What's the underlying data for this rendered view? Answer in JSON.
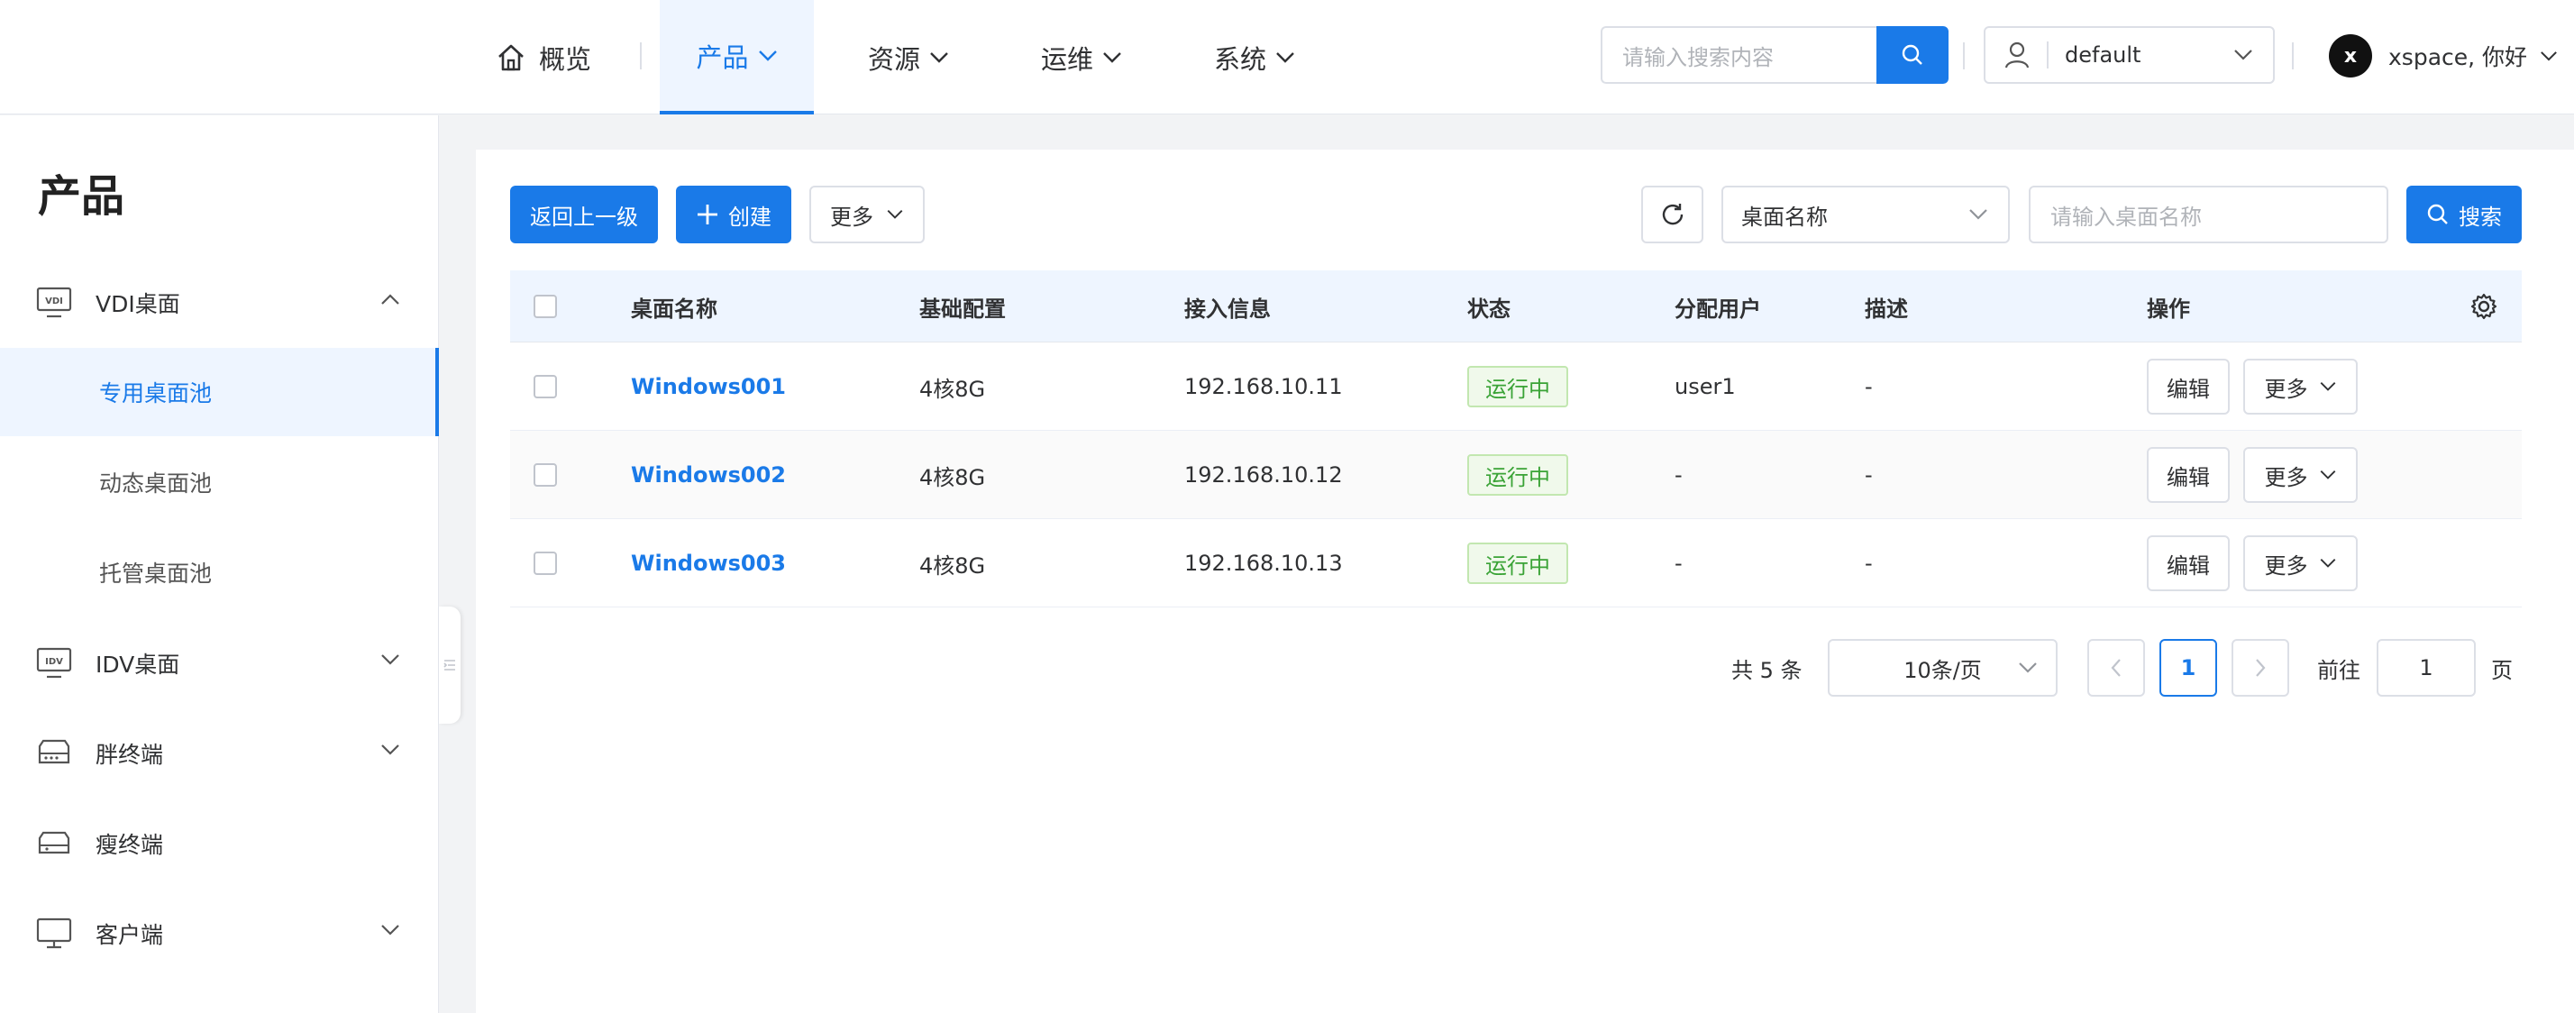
{
  "topbar": {
    "nav": [
      {
        "label": "概览",
        "icon": "home-icon"
      },
      {
        "label": "产品",
        "active": true
      },
      {
        "label": "资源"
      },
      {
        "label": "运维"
      },
      {
        "label": "系统"
      }
    ],
    "search_placeholder": "请输入搜索内容",
    "workspace": "default",
    "user_initial": "x",
    "user_greeting": "xspace, 你好"
  },
  "sidebar": {
    "title": "产品",
    "items": [
      {
        "label": "VDI桌面",
        "icon": "vdi-icon",
        "expanded": true,
        "children": [
          "专用桌面池",
          "动态桌面池",
          "托管桌面池"
        ],
        "active_child": "专用桌面池"
      },
      {
        "label": "IDV桌面",
        "icon": "idv-icon"
      },
      {
        "label": "胖终端",
        "icon": "fat-terminal-icon"
      },
      {
        "label": "瘦终端",
        "icon": "thin-terminal-icon"
      },
      {
        "label": "客户端",
        "icon": "monitor-icon"
      }
    ]
  },
  "toolbar": {
    "back_label": "返回上一级",
    "create_label": "创建",
    "more_label": "更多",
    "filter_field": "桌面名称",
    "filter_placeholder": "请输入桌面名称",
    "search_label": "搜索"
  },
  "table": {
    "columns": [
      "桌面名称",
      "基础配置",
      "接入信息",
      "状态",
      "分配用户",
      "描述",
      "操作"
    ],
    "rows": [
      {
        "name": "Windows001",
        "config": "4核8G",
        "address": "192.168.10.11",
        "status": "运行中",
        "user": "user1",
        "desc": "-"
      },
      {
        "name": "Windows002",
        "config": "4核8G",
        "address": "192.168.10.12",
        "status": "运行中",
        "user": "-",
        "desc": "-"
      },
      {
        "name": "Windows003",
        "config": "4核8G",
        "address": "192.168.10.13",
        "status": "运行中",
        "user": "-",
        "desc": "-"
      }
    ],
    "edit_label": "编辑",
    "more_label": "更多"
  },
  "pagination": {
    "total": "共 5 条",
    "page_size": "10条/页",
    "current_page": "1",
    "goto_prefix": "前往",
    "goto_value": "1",
    "goto_suffix": "页"
  },
  "colors": {
    "accent": "#1a7ae8",
    "status_green": "#3aa336"
  }
}
